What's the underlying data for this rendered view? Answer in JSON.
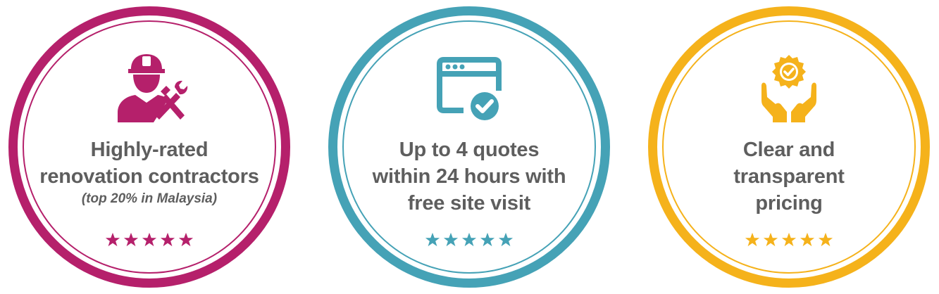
{
  "colors": {
    "badge_1": "#b5206b",
    "badge_2": "#45a2b6",
    "badge_3": "#f5b21b",
    "text": "#5e5e5e"
  },
  "badges": [
    {
      "icon": "contractor-worker-tools-icon",
      "headline_lines": [
        "Highly-rated",
        "renovation contractors"
      ],
      "subnote": "(top 20% in Malaysia)",
      "rating_stars": 5
    },
    {
      "icon": "browser-window-checkmark-icon",
      "headline_lines": [
        "Up to 4 quotes",
        "within 24 hours with",
        "free site visit"
      ],
      "subnote": "",
      "rating_stars": 5
    },
    {
      "icon": "hands-holding-certified-badge-icon",
      "headline_lines": [
        "Clear and",
        "transparent",
        "pricing"
      ],
      "subnote": "",
      "rating_stars": 5
    }
  ]
}
